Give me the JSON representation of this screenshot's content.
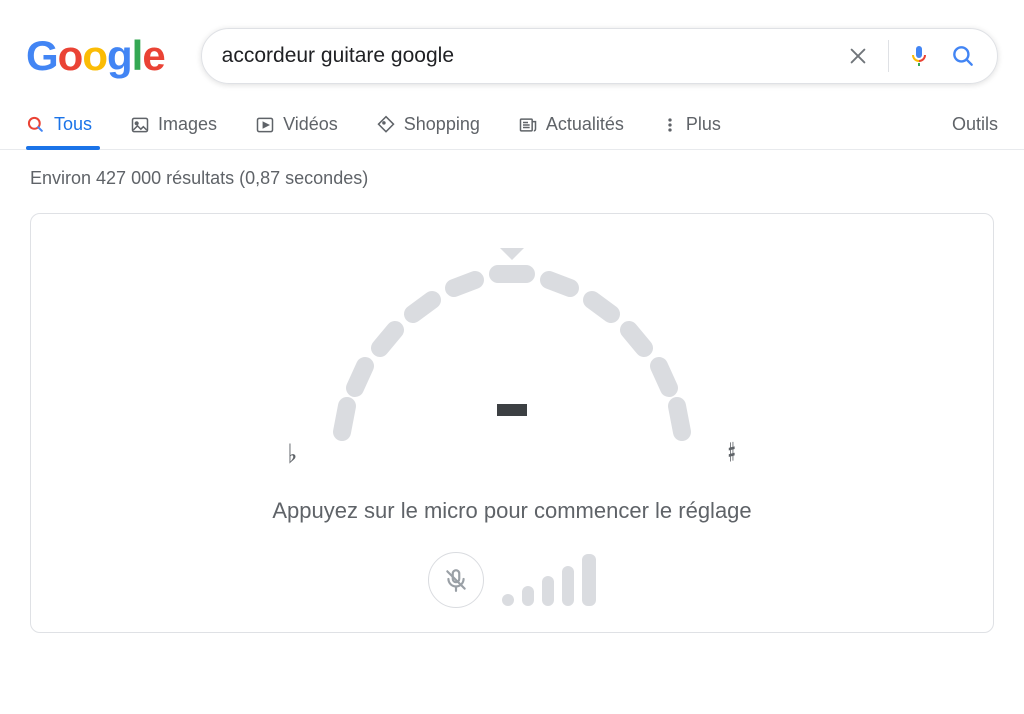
{
  "search": {
    "query": "accordeur guitare google",
    "clear_label": "Effacer",
    "voice_label": "Recherche vocale",
    "submit_label": "Recherche Google"
  },
  "tabs": {
    "all": "Tous",
    "images": "Images",
    "videos": "Vidéos",
    "shopping": "Shopping",
    "news": "Actualités",
    "more": "Plus",
    "tools": "Outils"
  },
  "stats": {
    "text": "Environ 427 000 résultats (0,87 secondes)"
  },
  "tuner": {
    "flat": "♭",
    "sharp": "♯",
    "instruction": "Appuyez sur le micro pour commencer le réglage"
  },
  "colors": {
    "accent": "#1a73e8",
    "text_secondary": "#5f6368",
    "dial": "#dadce0"
  }
}
